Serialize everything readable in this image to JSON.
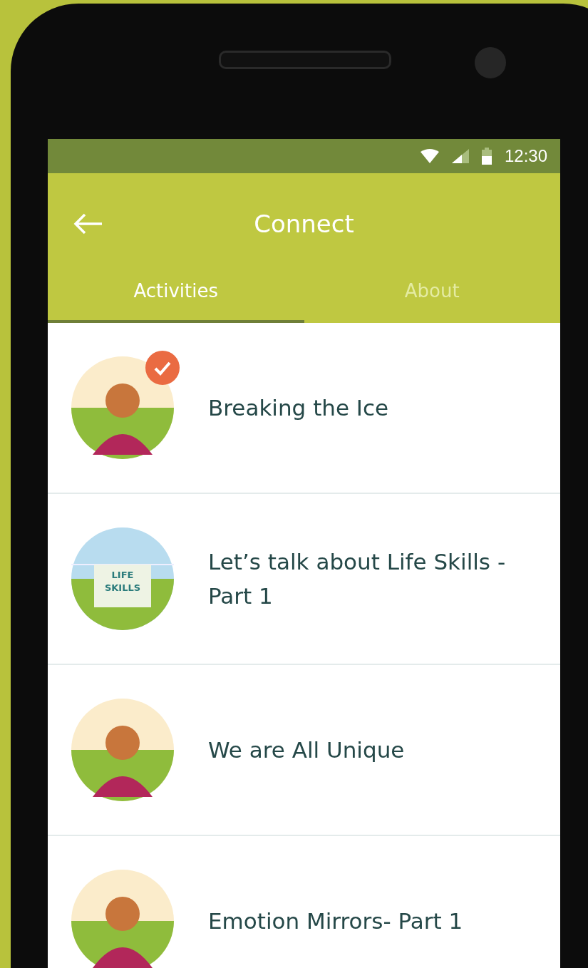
{
  "status_bar": {
    "time": "12:30"
  },
  "app_bar": {
    "title": "Connect"
  },
  "tabs": [
    {
      "label": "Activities",
      "selected": true
    },
    {
      "label": "About",
      "selected": false
    }
  ],
  "activities": [
    {
      "title": "Breaking the Ice",
      "done": true,
      "art": {
        "kind": "person"
      }
    },
    {
      "title": "Let’s talk about Life Skills - Part 1",
      "done": false,
      "art": {
        "kind": "sign",
        "sign": [
          "LIFE",
          "SKILLS"
        ]
      }
    },
    {
      "title": "We are All Unique",
      "done": false,
      "art": {
        "kind": "person"
      }
    },
    {
      "title": "Emotion Mirrors- Part 1",
      "done": false,
      "art": {
        "kind": "person"
      }
    }
  ]
}
